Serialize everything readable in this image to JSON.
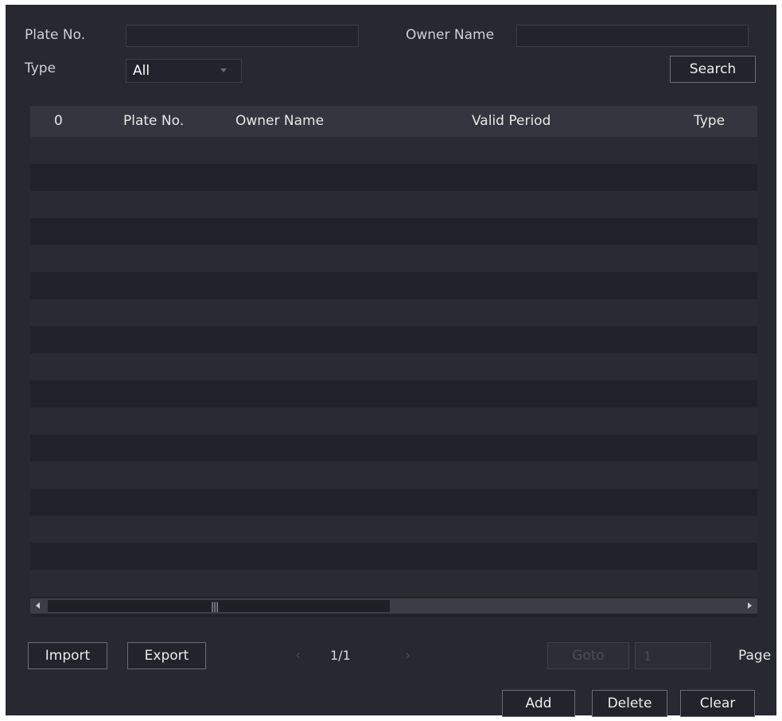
{
  "filters": {
    "plate_label": "Plate No.",
    "plate_value": "",
    "owner_label": "Owner Name",
    "owner_value": "",
    "type_label": "Type",
    "type_selected": "All",
    "search_button": "Search"
  },
  "table": {
    "columns": [
      "0",
      "Plate No.",
      "Owner Name",
      "Valid Period",
      "Type"
    ],
    "rows": []
  },
  "footer": {
    "import_button": "Import",
    "export_button": "Export",
    "prev_icon": "‹",
    "page_indicator": "1/1",
    "next_icon": "›",
    "goto_button": "Goto",
    "goto_page_value": "1",
    "page_label": "Page",
    "add_button": "Add",
    "delete_button": "Delete",
    "clear_button": "Clear"
  }
}
